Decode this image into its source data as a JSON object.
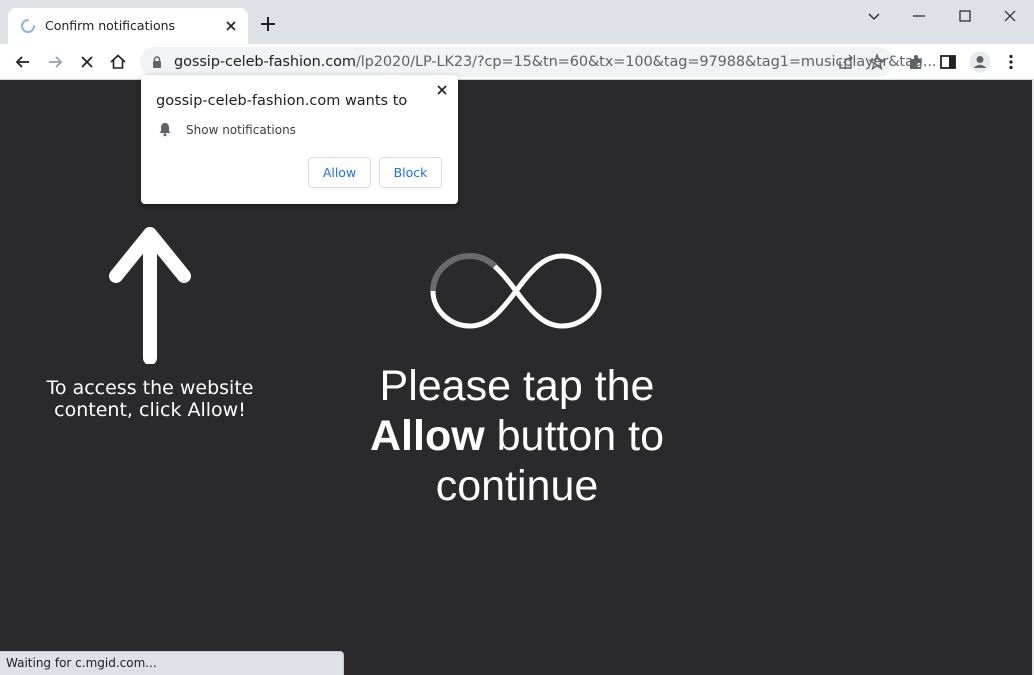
{
  "browser": {
    "tab_title": "Confirm notifications",
    "url_host": "gossip-celeb-fashion.com",
    "url_rest": "/lp2020/LP-LK23/?cp=15&tn=60&tx=100&tag=97988&tag1=musicplayer&tag...",
    "status_text": "Waiting for c.mgid.com..."
  },
  "permission_popup": {
    "title": "gossip-celeb-fashion.com wants to",
    "permission": "Show notifications",
    "allow_label": "Allow",
    "block_label": "Block"
  },
  "page": {
    "hint": "To access the website content, click Allow!",
    "headline_line1": "Please tap the",
    "headline_bold": "Allow",
    "headline_after_bold": " button to",
    "headline_line3": "continue"
  },
  "colors": {
    "page_bg": "#2a2a2d",
    "accent": "#1a73e8"
  },
  "icons": {
    "back": "arrow-left-icon",
    "forward": "arrow-right-icon",
    "stop": "close-icon",
    "home": "home-icon",
    "lock": "lock-icon",
    "share": "share-icon",
    "bookmark": "star-icon",
    "extensions": "puzzle-icon",
    "side_panel": "side-panel-icon",
    "profile": "avatar-icon",
    "menu": "kebab-menu-icon",
    "bell": "bell-icon",
    "spinner": "loading-spinner-icon"
  }
}
